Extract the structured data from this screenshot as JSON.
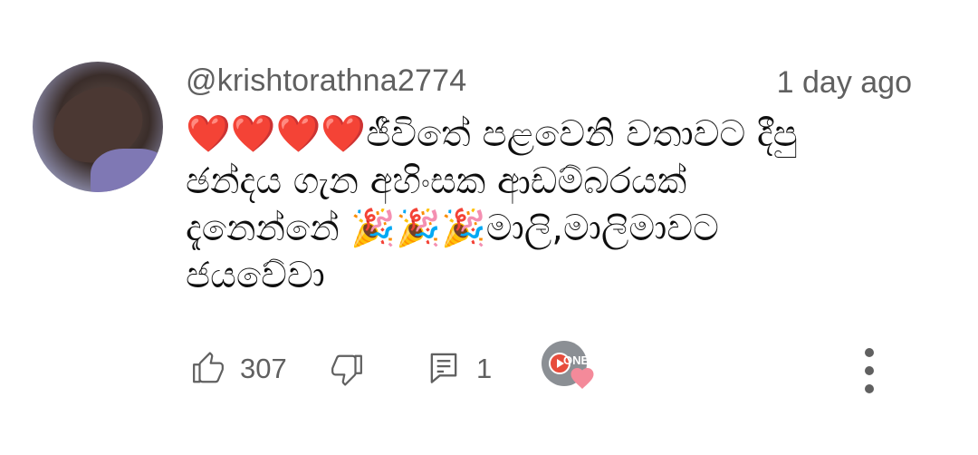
{
  "comment": {
    "username": "@krishtorathna2774",
    "timestamp": "1 day ago",
    "lines": [
      "❤️❤️❤️❤️ජීවිතේ පළවෙනි වතාවට දීපු",
      "ඡන්දය ගැන අහිංසක ආඩම්බරයක්",
      "දැනෙන්නේ 🎉🎉🎉මාලි,මාලිමාවට",
      "ජයවේවා"
    ]
  },
  "actions": {
    "like_count": "307",
    "reply_count": "1",
    "creator_badge_text": "ONE"
  },
  "icons": {
    "like": "thumbs-up-icon",
    "dislike": "thumbs-down-icon",
    "reply": "reply-comment-icon",
    "creator_heart": "creator-heart-icon",
    "more": "more-vertical-icon"
  },
  "colors": {
    "secondary_text": "#606060",
    "heart_pink": "#f48a9a"
  }
}
